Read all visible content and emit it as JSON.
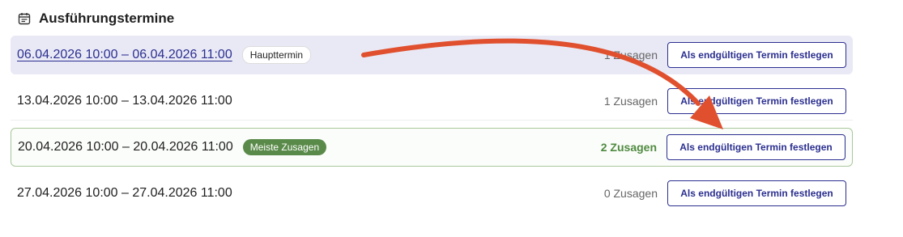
{
  "section": {
    "title": "Ausführungstermine",
    "icon": "calendar-icon"
  },
  "rows": [
    {
      "datetime": "06.04.2026 10:00 – 06.04.2026 11:00",
      "badge": "Haupttermin",
      "count": "1 Zusagen",
      "button": "Als endgültigen Termin festlegen"
    },
    {
      "datetime": "13.04.2026 10:00 – 13.04.2026 11:00",
      "count": "1 Zusagen",
      "button": "Als endgültigen Termin festlegen"
    },
    {
      "datetime": "20.04.2026 10:00 – 20.04.2026 11:00",
      "badge": "Meiste Zusagen",
      "count": "2 Zusagen",
      "button": "Als endgültigen Termin festlegen"
    },
    {
      "datetime": "27.04.2026 10:00 – 27.04.2026 11:00",
      "count": "0 Zusagen",
      "button": "Als endgültigen Termin festlegen"
    }
  ],
  "colors": {
    "accent": "#2b2f8f",
    "highlight_row": "#e9e9f6",
    "success": "#5a8a4a",
    "annotation_arrow": "#e0502e"
  }
}
